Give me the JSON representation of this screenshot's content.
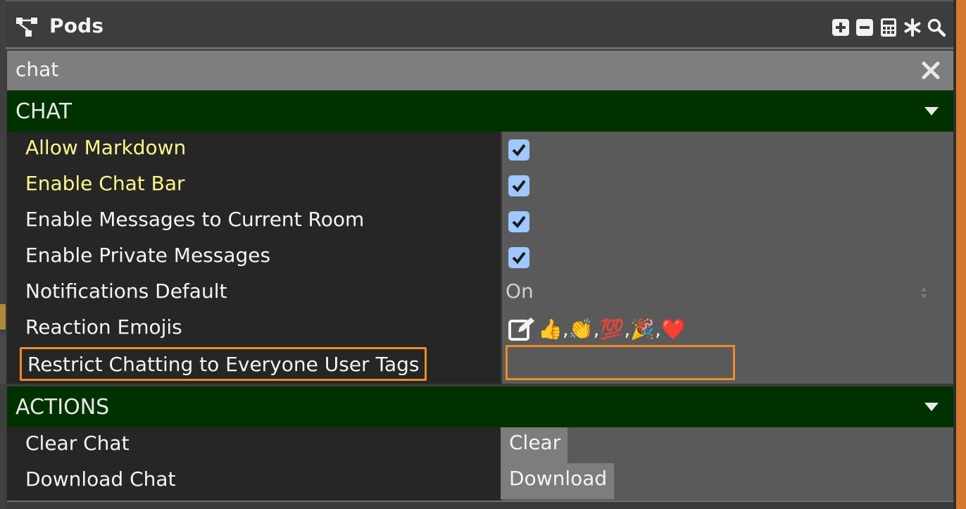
{
  "window": {
    "title": "Pods"
  },
  "toolbar": {
    "icons": [
      "add-icon",
      "remove-icon",
      "calculator-icon",
      "asterisk-icon",
      "search-icon"
    ]
  },
  "search": {
    "value": "chat"
  },
  "sections": {
    "chat": {
      "title": "CHAT",
      "rows": {
        "allow_markdown": {
          "label": "Allow Markdown",
          "checked": true
        },
        "enable_chat_bar": {
          "label": "Enable Chat Bar",
          "checked": true
        },
        "enable_messages_room": {
          "label": "Enable Messages to Current Room",
          "checked": true
        },
        "enable_private": {
          "label": "Enable Private Messages",
          "checked": true
        },
        "notifications_default": {
          "label": "Notifications Default",
          "value": "On"
        },
        "reaction_emojis": {
          "label": "Reaction Emojis",
          "value": "👍,👏,💯,🎉,❤️"
        },
        "restrict_chatting": {
          "label": "Restrict Chatting to Everyone User Tags",
          "value": ""
        }
      }
    },
    "actions": {
      "title": "ACTIONS",
      "rows": {
        "clear_chat": {
          "label": "Clear Chat",
          "button": "Clear"
        },
        "download_chat": {
          "label": "Download Chat",
          "button": "Download"
        }
      }
    }
  },
  "colors": {
    "section_header": "#003200",
    "modified_label": "#fff68a",
    "highlight": "#f08a24",
    "checkbox": "#9ec8ff"
  }
}
